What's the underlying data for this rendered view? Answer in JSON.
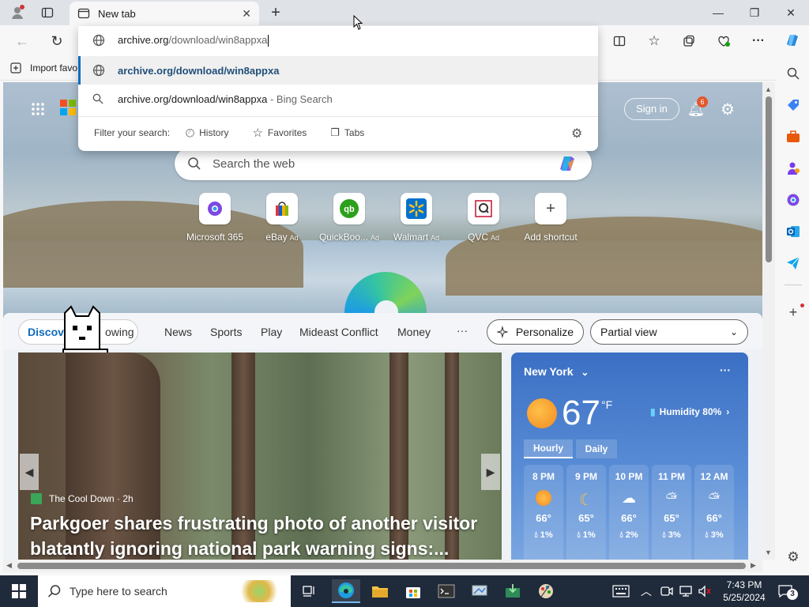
{
  "tab": {
    "title": "New tab"
  },
  "address": {
    "host": "archive.org",
    "path": "/download/win8appxa"
  },
  "suggestions": [
    {
      "text": "archive.org/download/win8appxa",
      "suffix": ""
    },
    {
      "text": "archive.org/download/win8appxa",
      "suffix": " - Bing Search"
    }
  ],
  "filter": {
    "label": "Filter your search:",
    "history": "History",
    "favorites": "Favorites",
    "tabs": "Tabs"
  },
  "favbar": {
    "import": "Import favo"
  },
  "header": {
    "sign_in": "Sign in",
    "notifications": "6"
  },
  "search": {
    "placeholder": "Search the web"
  },
  "shortcuts": [
    {
      "label": "Microsoft 365",
      "ad": ""
    },
    {
      "label": "eBay",
      "ad": "Ad"
    },
    {
      "label": "QuickBoo...",
      "ad": "Ad"
    },
    {
      "label": "Walmart",
      "ad": "Ad"
    },
    {
      "label": "QVC",
      "ad": "Ad"
    },
    {
      "label": "Add shortcut",
      "ad": ""
    }
  ],
  "feed_nav": {
    "discover": "Discov",
    "following": "owing",
    "news": "News",
    "sports": "Sports",
    "play": "Play",
    "mideast": "Mideast Conflict",
    "money": "Money",
    "more": "···",
    "personalize": "Personalize",
    "view": "Partial view"
  },
  "article": {
    "source": "The Cool Down · 2h",
    "headline": "Parkgoer shares frustrating photo of another visitor blatantly ignoring national park warning signs:..."
  },
  "weather": {
    "city": "New York",
    "temp": "67",
    "unit": "°F",
    "humidity": "Humidity 80%",
    "tabs": [
      "Hourly",
      "Daily"
    ],
    "hours": [
      {
        "time": "8 PM",
        "temp": "66°",
        "precip": "1%",
        "icon": "sun-icon"
      },
      {
        "time": "9 PM",
        "temp": "65°",
        "precip": "1%",
        "icon": "moon-icon"
      },
      {
        "time": "10 PM",
        "temp": "66°",
        "precip": "2%",
        "icon": "partly-cloudy-night-icon"
      },
      {
        "time": "11 PM",
        "temp": "65°",
        "precip": "3%",
        "icon": "partly-cloudy-icon"
      },
      {
        "time": "12 AM",
        "temp": "66°",
        "precip": "3%",
        "icon": "partly-cloudy-icon"
      }
    ]
  },
  "taskbar": {
    "search_placeholder": "Type here to search",
    "time": "7:43 PM",
    "date": "5/25/2024",
    "notif_count": "3"
  },
  "colors": {
    "accent": "#0f6cbd",
    "taskbar": "#1f2a3a"
  }
}
